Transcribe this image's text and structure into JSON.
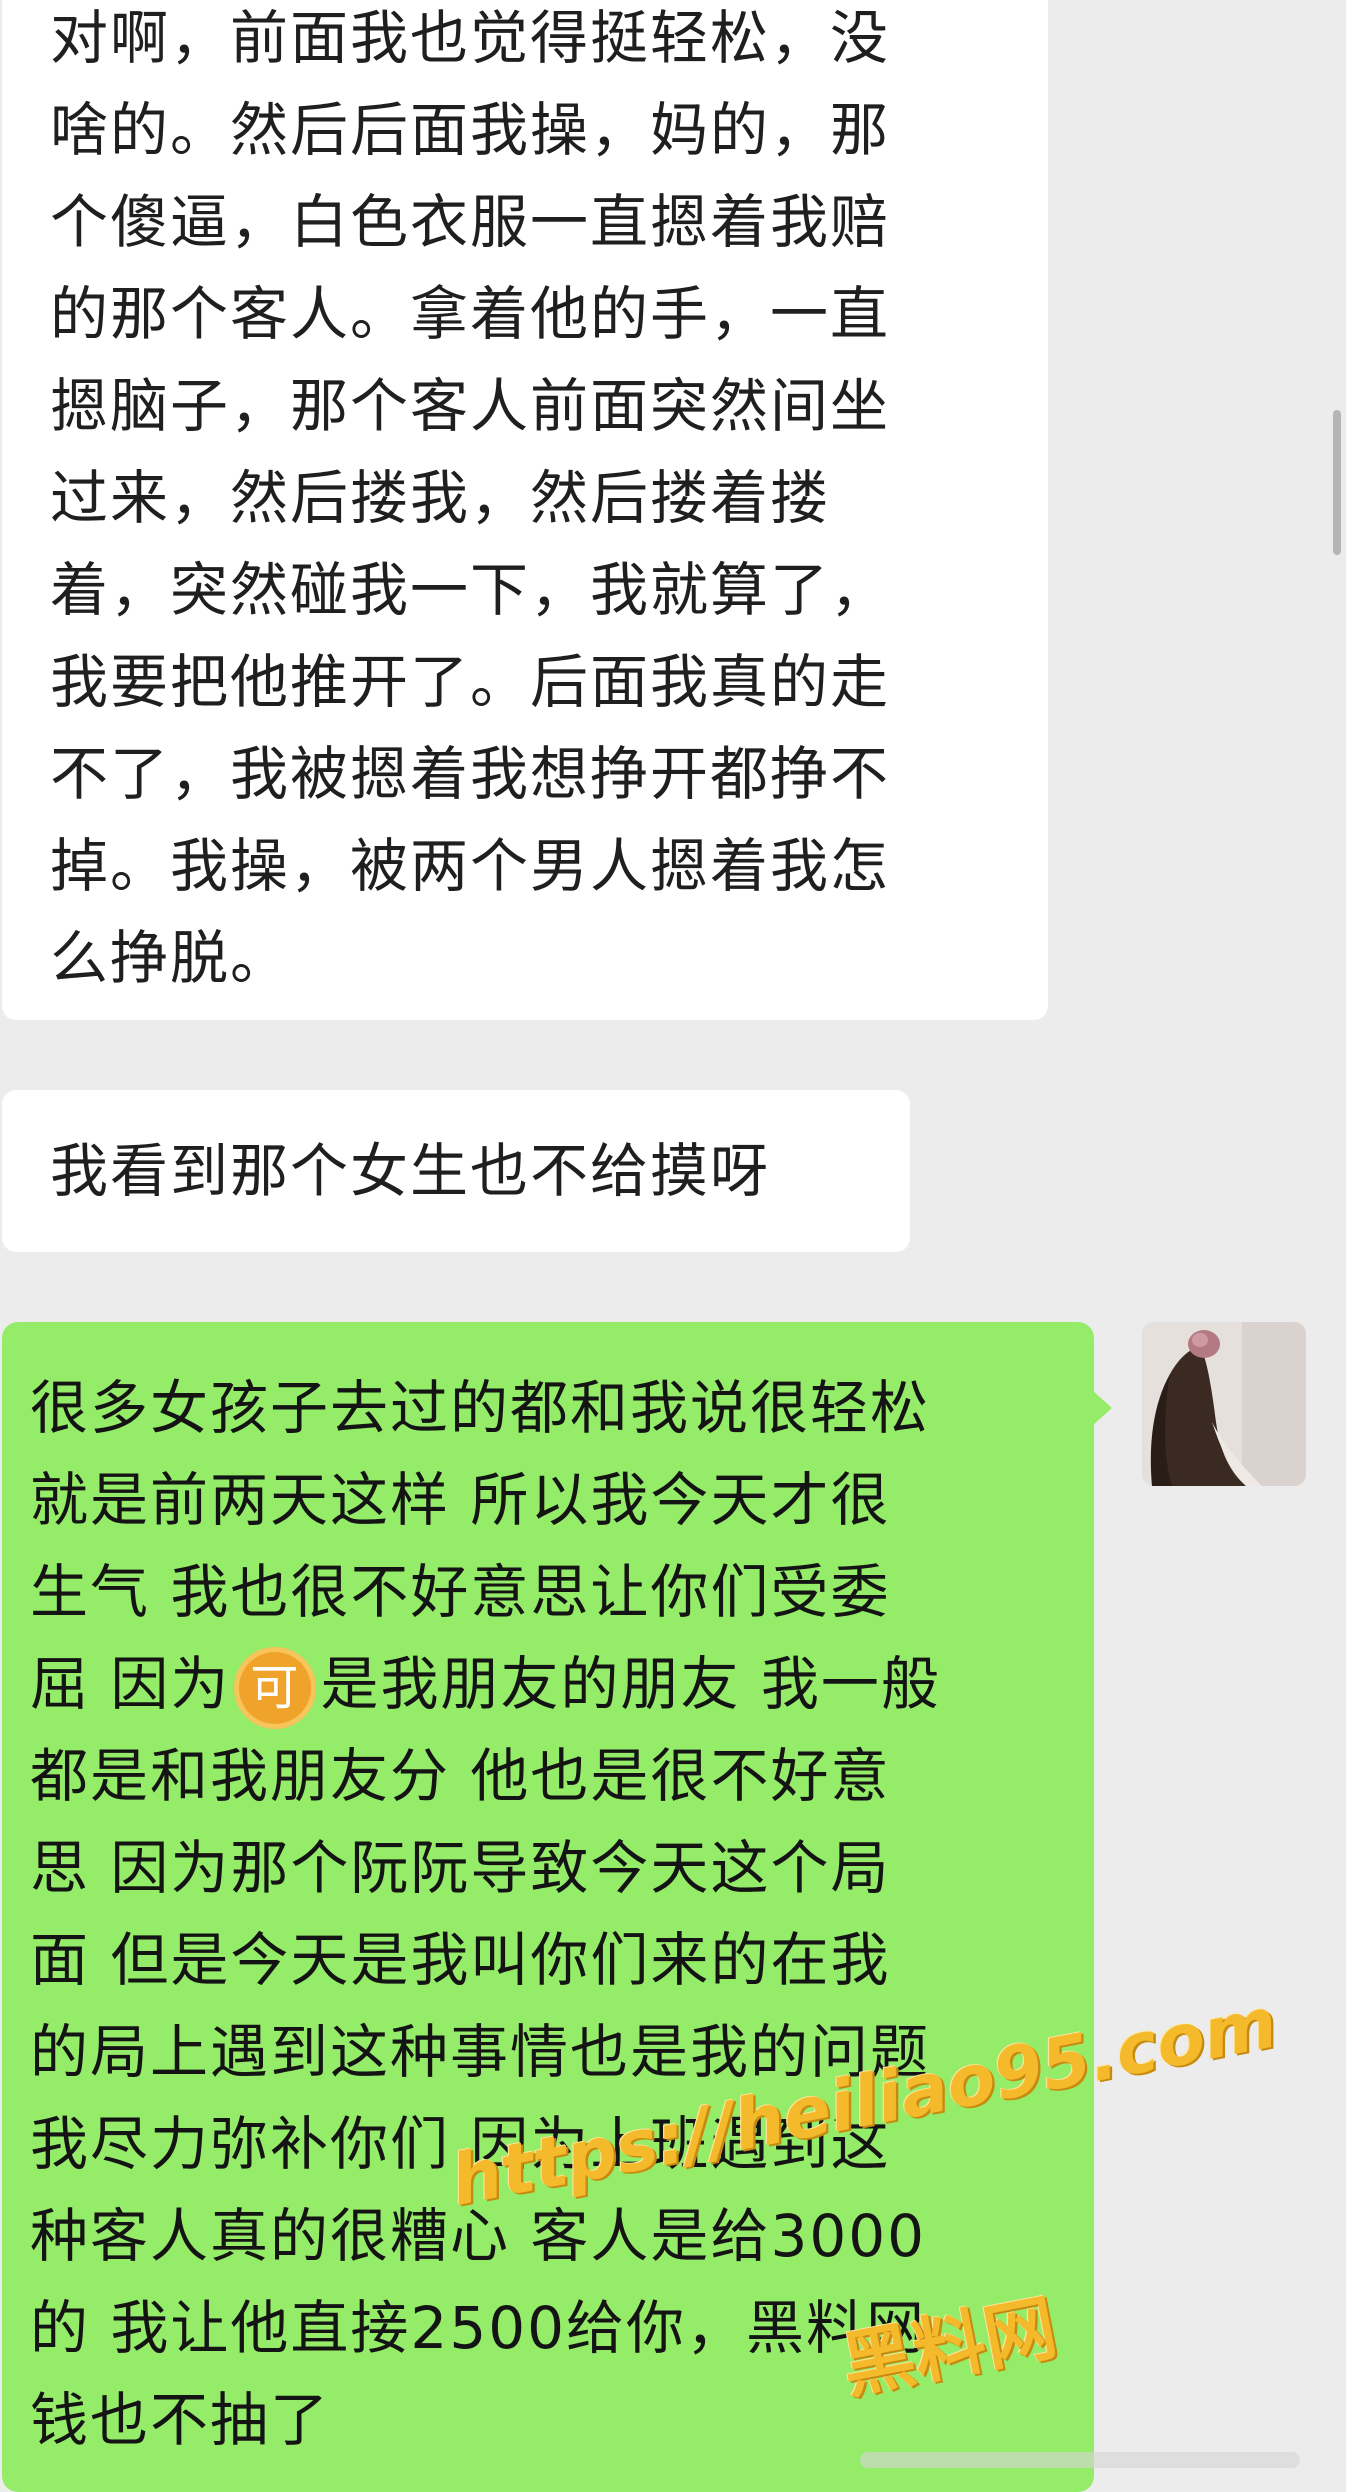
{
  "chat": {
    "messages": [
      {
        "side": "incoming",
        "text": "对啊，前面我也觉得挺轻松，没\n啥的。然后后面我操，妈的，那\n个傻逼，白色衣服一直摁着我赔\n的那个客人。拿着他的手，一直\n摁脑子，那个客人前面突然间坐\n过来，然后搂我，然后搂着搂\n着，突然碰我一下，我就算了，\n我要把他推开了。后面我真的走\n不了，我被摁着我想挣开都挣不\n掉。我操，被两个男人摁着我怎\n么挣脱。"
      },
      {
        "side": "incoming",
        "text": "我看到那个女生也不给摸呀"
      },
      {
        "side": "outgoing",
        "text_before_emoji": "很多女孩子去过的都和我说很轻松\n就是前两天这样 所以我今天才很\n生气 我也很不好意思让你们受委\n屈 因为",
        "emoji": "可",
        "text_after_emoji": "是我朋友的朋友 我一般\n都是和我朋友分  他也是很不好意\n思 因为那个阮阮导致今天这个局\n面 但是今天是我叫你们来的在我\n的局上遇到这种事情也是我的问题\n我尽力弥补你们  因为上班遇到这\n种客人真的很糟心 客人是给3000\n的 我让他直接2500给你，黑料网\n钱也不抽了"
      }
    ]
  },
  "avatar": {
    "icon": "user-avatar-photo"
  },
  "watermark": {
    "url": "https://heiliao95.com",
    "brand": "黑料网"
  },
  "colors": {
    "background": "#ececec",
    "incoming_bubble": "#ffffff",
    "outgoing_bubble": "#95ec69",
    "watermark": "#f5b92c"
  }
}
